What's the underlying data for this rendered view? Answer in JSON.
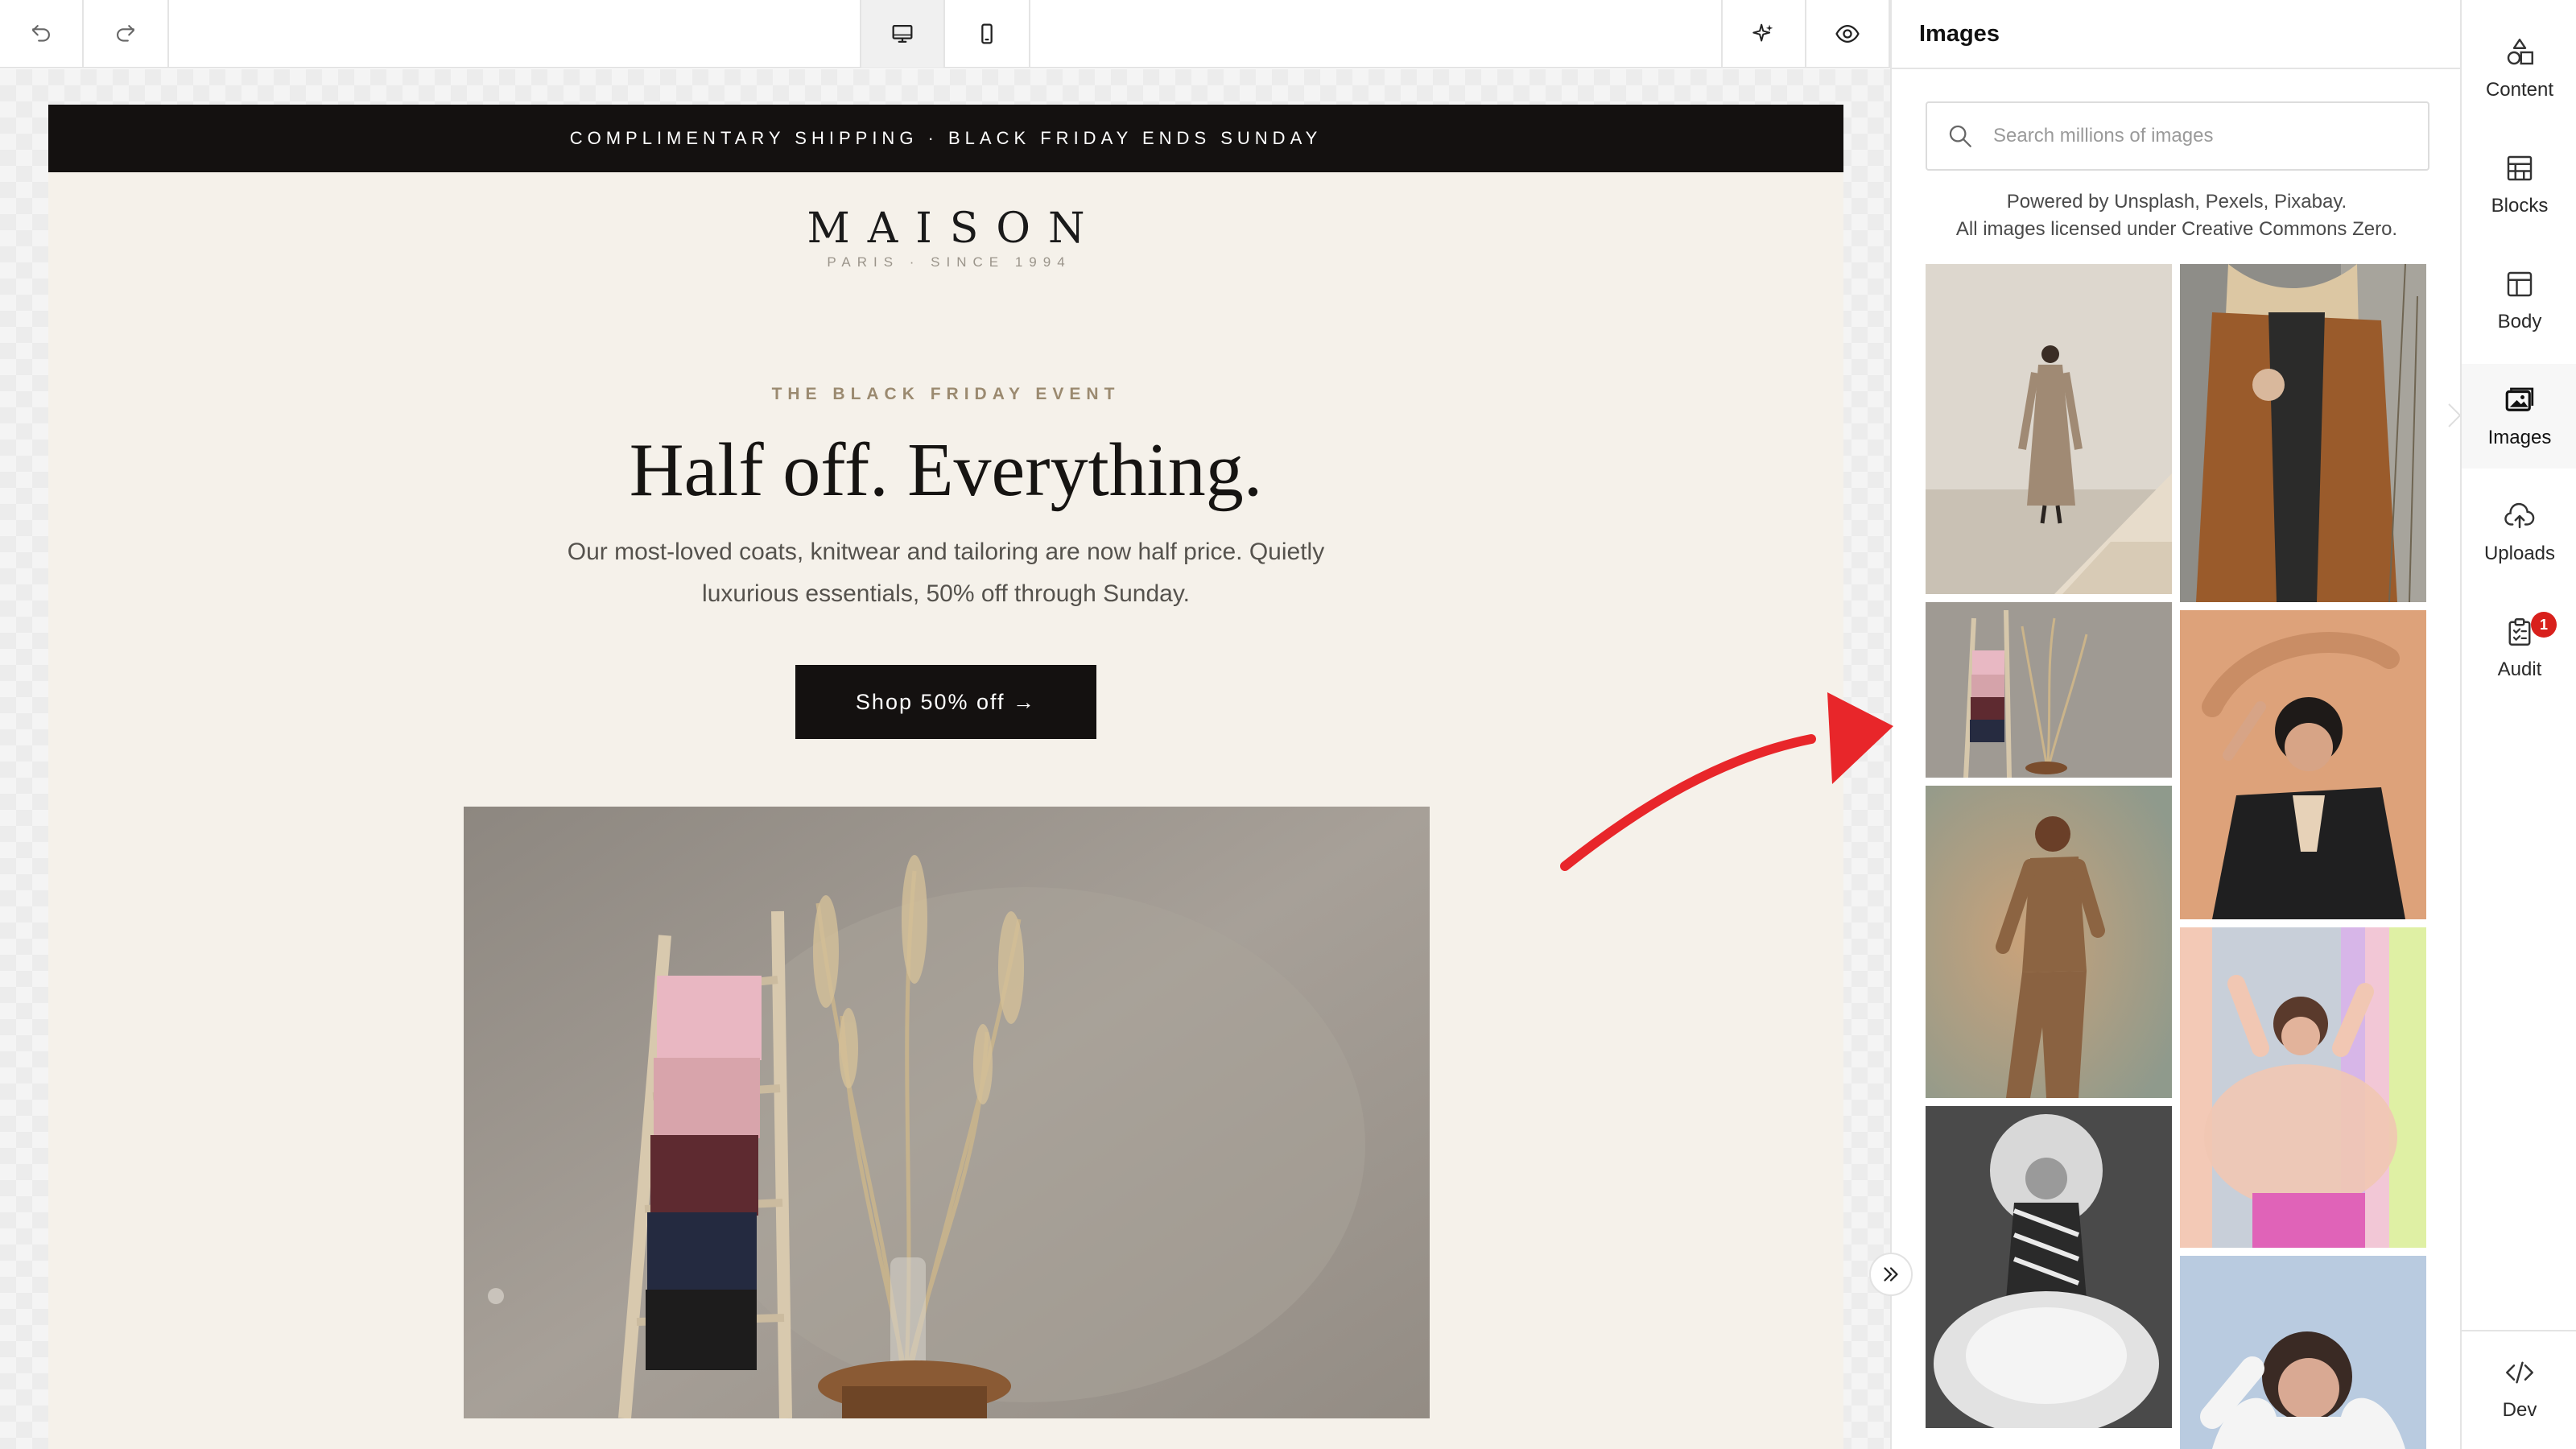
{
  "toolbar": {
    "undo_icon": "undo-icon",
    "redo_icon": "redo-icon",
    "desktop_icon": "desktop-icon",
    "mobile_icon": "mobile-icon",
    "ai_icon": "sparkle-icon",
    "preview_icon": "eye-icon",
    "active_view": "desktop"
  },
  "email": {
    "promo_bar": "COMPLIMENTARY SHIPPING  ·  BLACK FRIDAY ENDS SUNDAY",
    "logo": "MAISON",
    "logo_sub": "PARIS · SINCE 1994",
    "eyebrow": "THE BLACK FRIDAY EVENT",
    "headline": "Half off. Everything.",
    "body": "Our most-loved coats, knitwear and tailoring are now half price. Quietly luxurious essentials, 50% off through Sunday.",
    "cta": "Shop 50% off →",
    "colors": {
      "background": "#f5f1ea",
      "dark": "#141110",
      "eyebrow": "#9b8a70"
    }
  },
  "panel": {
    "title": "Images",
    "search_placeholder": "Search millions of images",
    "powered_line1": "Powered by Unsplash, Pexels, Pixabay.",
    "powered_line2": "All images licensed under Creative Commons Zero.",
    "images": [
      {
        "name": "thumb-beige-coat-stairs",
        "description_icon": "photo"
      },
      {
        "name": "thumb-brown-coat-field",
        "description_icon": "photo"
      },
      {
        "name": "thumb-ladder-pampas",
        "description_icon": "photo"
      },
      {
        "name": "thumb-black-blazer-pose",
        "description_icon": "photo"
      },
      {
        "name": "thumb-camel-suit",
        "description_icon": "photo"
      },
      {
        "name": "thumb-pink-tulle",
        "description_icon": "photo"
      },
      {
        "name": "thumb-bw-curly-hair",
        "description_icon": "photo"
      },
      {
        "name": "thumb-white-shirt-portrait",
        "description_icon": "photo"
      }
    ]
  },
  "rail": {
    "items": [
      {
        "label": "Content",
        "icon": "shapes-icon"
      },
      {
        "label": "Blocks",
        "icon": "blocks-icon"
      },
      {
        "label": "Body",
        "icon": "layout-icon"
      },
      {
        "label": "Images",
        "icon": "image-icon"
      },
      {
        "label": "Uploads",
        "icon": "cloud-upload-icon"
      },
      {
        "label": "Audit",
        "icon": "clipboard-icon",
        "badge": "1"
      }
    ],
    "dev_label": "Dev",
    "active": "Images"
  },
  "annotation": {
    "arrow_color": "#e8262a"
  }
}
